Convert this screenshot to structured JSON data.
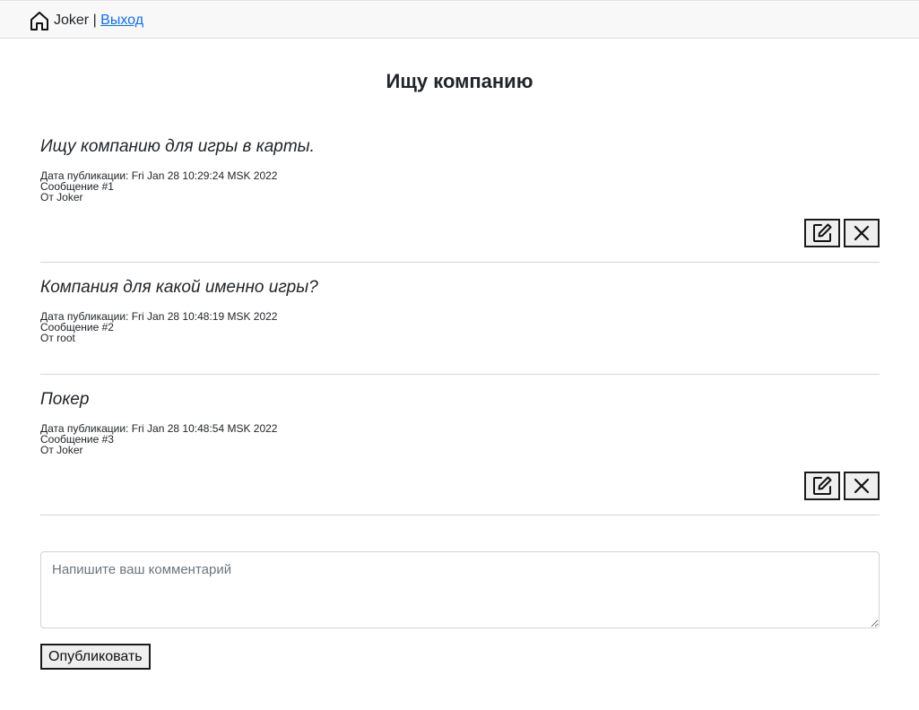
{
  "header": {
    "home_icon": "home-icon",
    "username": "Joker",
    "separator": " | ",
    "logout_label": "Выход"
  },
  "page": {
    "title": "Ищу компанию"
  },
  "posts": [
    {
      "text": "Ищу компанию для игры в карты.",
      "date_line": "Дата публикации: Fri Jan 28 10:29:24 MSK 2022",
      "message_line": "Сообщение #1",
      "author_line": "От Joker",
      "editable": true
    },
    {
      "text": "Компания для какой именно игры?",
      "date_line": "Дата публикации: Fri Jan 28 10:48:19 MSK 2022",
      "message_line": "Сообщение #2",
      "author_line": "От root",
      "editable": false
    },
    {
      "text": "Покер",
      "date_line": "Дата публикации: Fri Jan 28 10:48:54 MSK 2022",
      "message_line": "Сообщение #3",
      "author_line": "От Joker",
      "editable": true
    }
  ],
  "icons": {
    "edit": "edit-icon",
    "delete": "close-icon"
  },
  "comment_form": {
    "placeholder": "Напишите ваш комментарий",
    "value": "",
    "submit_label": "Опубликовать"
  }
}
